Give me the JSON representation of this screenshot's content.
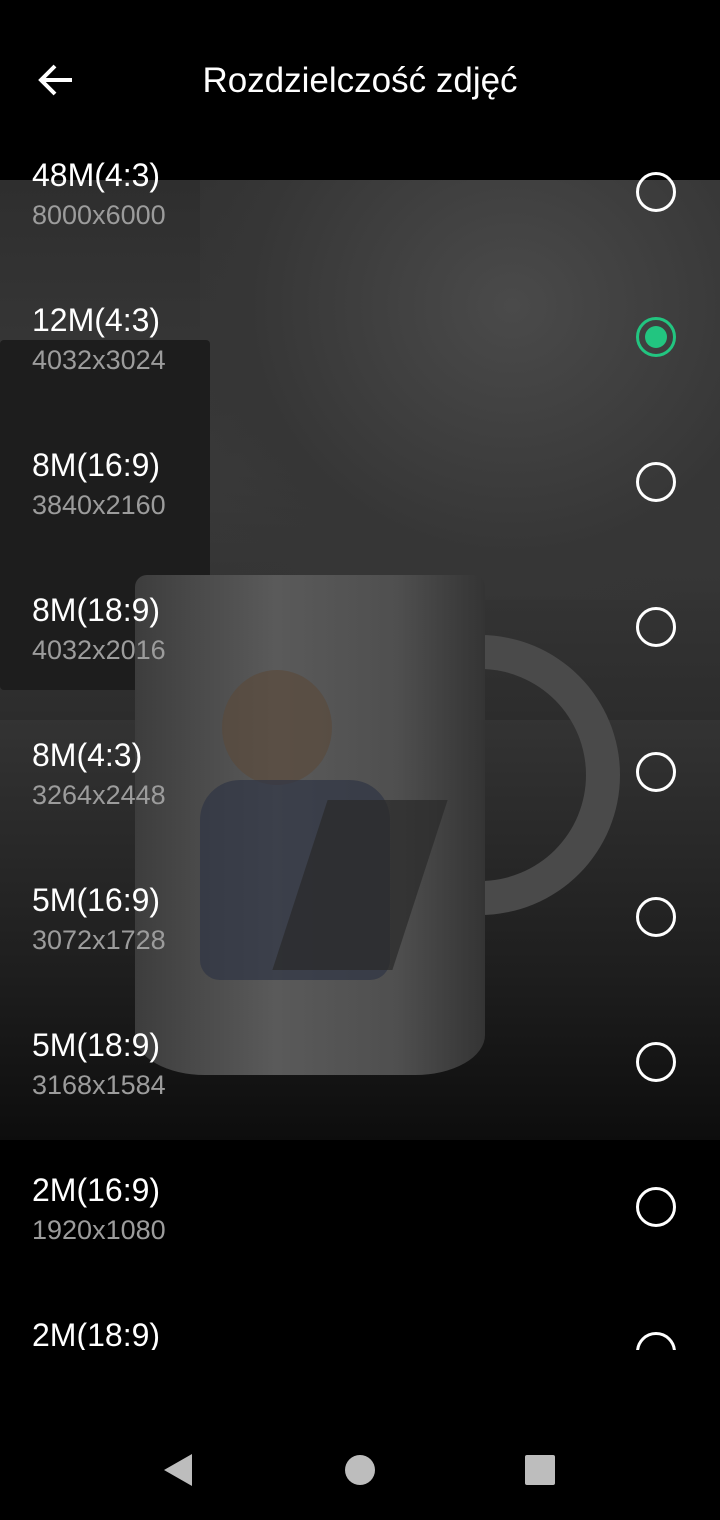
{
  "header": {
    "title": "Rozdzielczość zdjęć",
    "back_icon": "arrow-back-icon"
  },
  "colors": {
    "accent": "#22c580",
    "background": "#000000",
    "subtext": "#9c9c9c"
  },
  "resolutions": [
    {
      "label": "48M(4:3)",
      "size": "8000x6000",
      "selected": false
    },
    {
      "label": "12M(4:3)",
      "size": "4032x3024",
      "selected": true
    },
    {
      "label": "8M(16:9)",
      "size": "3840x2160",
      "selected": false
    },
    {
      "label": "8M(18:9)",
      "size": "4032x2016",
      "selected": false
    },
    {
      "label": "8M(4:3)",
      "size": "3264x2448",
      "selected": false
    },
    {
      "label": "5M(16:9)",
      "size": "3072x1728",
      "selected": false
    },
    {
      "label": "5M(18:9)",
      "size": "3168x1584",
      "selected": false
    },
    {
      "label": "2M(16:9)",
      "size": "1920x1080",
      "selected": false
    },
    {
      "label": "2M(18:9)",
      "size": "",
      "selected": false
    }
  ],
  "navbar": {
    "back_icon": "nav-back-triangle-icon",
    "home_icon": "nav-home-circle-icon",
    "recents_icon": "nav-recents-square-icon"
  }
}
